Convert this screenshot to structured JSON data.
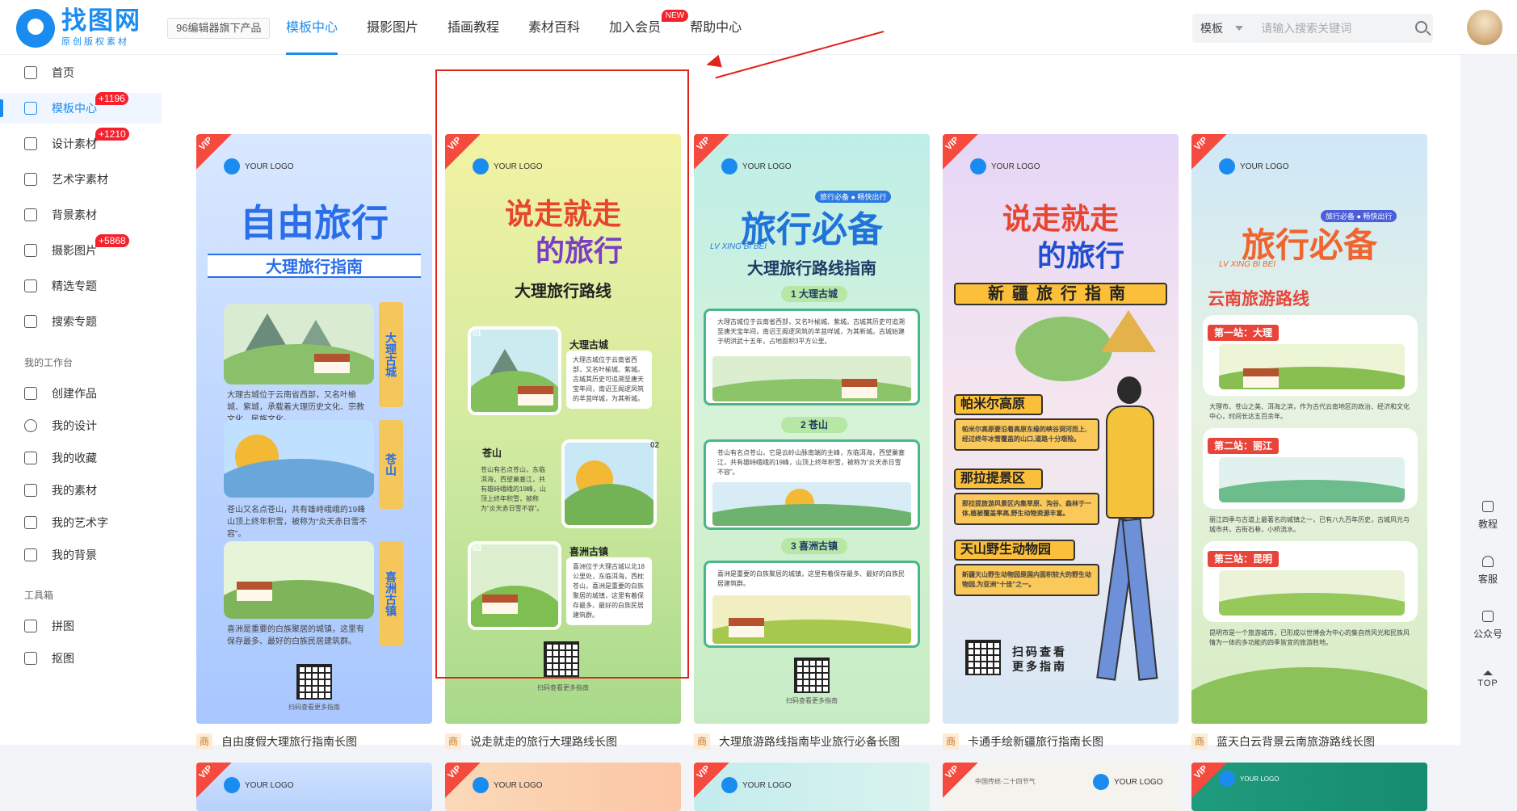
{
  "logo": {
    "name": "找图网",
    "subtitle": "原创版权素材"
  },
  "product_tag": "96编辑器旗下产品",
  "nav": [
    {
      "label": "模板中心",
      "active": true
    },
    {
      "label": "摄影图片"
    },
    {
      "label": "插画教程"
    },
    {
      "label": "素材百科"
    },
    {
      "label": "加入会员",
      "badge": "NEW"
    },
    {
      "label": "帮助中心"
    }
  ],
  "search": {
    "type": "模板",
    "placeholder": "请输入搜索关键词"
  },
  "sidebar": {
    "items": [
      {
        "label": "首页",
        "icon": "home-icon"
      },
      {
        "label": "模板中心",
        "icon": "template-icon",
        "badge": "+1196",
        "active": true
      },
      {
        "label": "设计素材",
        "icon": "design-material-icon",
        "badge": "+1210"
      },
      {
        "label": "艺术字素材",
        "icon": "art-text-icon"
      },
      {
        "label": "背景素材",
        "icon": "background-icon"
      },
      {
        "label": "摄影图片",
        "icon": "photo-icon",
        "badge": "+5868"
      },
      {
        "label": "精选专题",
        "icon": "featured-topic-icon"
      },
      {
        "label": "搜索专题",
        "icon": "search-topic-icon"
      }
    ],
    "workspace_title": "我的工作台",
    "workspace": [
      {
        "label": "创建作品",
        "icon": "create-icon"
      },
      {
        "label": "我的设计",
        "icon": "my-design-icon"
      },
      {
        "label": "我的收藏",
        "icon": "star-icon"
      },
      {
        "label": "我的素材",
        "icon": "folder-icon"
      },
      {
        "label": "我的艺术字",
        "icon": "letter-a-icon"
      },
      {
        "label": "我的背景",
        "icon": "texture-icon"
      }
    ],
    "tools_title": "工具箱",
    "tools": [
      {
        "label": "拼图",
        "icon": "collage-icon"
      },
      {
        "label": "抠图",
        "icon": "cutout-icon"
      }
    ]
  },
  "cards": [
    {
      "tag": "商",
      "title": "自由度假大理旅行指南长图",
      "vip": "VIP",
      "logo": "YOUR LOGO",
      "poster": {
        "headline": "自由旅行",
        "band": "大理旅行指南",
        "side1": "大理古城",
        "side2": "苍山",
        "side3": "喜洲古镇",
        "text1": "大理古城位于云南省西部，又名叶榆城、紫城，承载着大理历史文化、宗教文化、民族文化。",
        "text2": "苍山又名点苍山，共有雄峙峨峨的19峰山顶上终年积雪，被称为“炎天赤日雪不容”。",
        "text3": "喜洲是重要的白族聚居的城镇，这里有保存最多、最好的白族民居建筑群。",
        "qr_text": "扫码查看更多指南"
      }
    },
    {
      "tag": "商",
      "title": "说走就走的旅行大理路线长图",
      "vip": "VIP",
      "logo": "YOUR LOGO",
      "poster": {
        "headline1": "说走就走",
        "headline2": "的旅行",
        "band": "大理旅行路线",
        "s1": "大理古城",
        "n1": "01",
        "s2": "苍山",
        "n2": "02",
        "s3": "喜洲古镇",
        "n3": "03",
        "t1": "大理古城位于云南省西部，又名叶榆城、紫城。古城其历史可追溯至唐天宝年间，南诏王阁逻凤筑的羊苴咩城，为其新城。",
        "t2": "苍山有名点苍山，东临洱海，西望巢塞江，共有雄峙峨峨的19峰，山顶上终年积雪，被称为“炎天赤日雪不容”。",
        "t3": "喜洲位于大理古城以北18公里处，东临洱海，西枕苍山，喜洲是重要的白族聚居的城镇，这里有着保存最多、最好的白族民居建筑群。",
        "qr_text": "扫码查看更多指南"
      }
    },
    {
      "tag": "商",
      "title": "大理旅游路线指南毕业旅行必备长图",
      "vip": "VIP",
      "logo": "YOUR LOGO",
      "poster": {
        "headline": "旅行必备",
        "tagline": "旅行必备 ● 畅快出行",
        "pinyin": "LV  XING  BI  BEI",
        "band": "大理旅行路线指南",
        "s1": "1 大理古城",
        "s2": "2 苍山",
        "s3": "3 喜洲古镇",
        "t1": "大理古城位于云南省西部，又名叶榆城、紫城。古城其历史可追溯至唐天宝年间，南诏王阁逻凤筑的羊苴咩城，为其新城。古城始建于明洪武十五年，占地面积3平方公里。",
        "t2": "苍山有名点苍山，它是云岭山脉南端的主峰，东临洱海，西望巢塞江，共有雄峙峨峨的19峰，山顶上终年积雪，被称为“炎天赤日雪不容”。",
        "t3": "喜洲是重要的白族聚居的城镇，这里有着保存最多、最好的白族民居建筑群。",
        "qr_text": "扫码查看更多指南"
      }
    },
    {
      "tag": "商",
      "title": "卡通手绘新疆旅行指南长图",
      "vip": "VIP",
      "logo": "YOUR LOGO",
      "poster": {
        "headline1": "说走就走",
        "headline2": "的旅行",
        "band": "新疆旅行指南",
        "s1": "帕米尔高原",
        "t1": "帕米尔高原要沿着高原东缘的峡谷洞河而上,经过终年冰雪覆盖的山口,道路十分艰险。",
        "s2": "那拉提景区",
        "t2": "那拉提旅游风景区内集草原、沟谷、森林于一体,植被覆盖率高,野生动物资源丰富。",
        "s3": "天山野生动物园",
        "t3": "新疆天山野生动物园是国内面积较大的野生动物园,为亚洲“十佳”之一。",
        "qr_text": "扫码查看更多指南"
      }
    },
    {
      "tag": "商",
      "title": "蓝天白云背景云南旅游路线长图",
      "vip": "VIP",
      "logo": "YOUR LOGO",
      "poster": {
        "headline": "旅行必备",
        "tagline": "旅行必备 ● 畅快出行",
        "pinyin": "LV  XING  BI  BEI",
        "band": "云南旅游路线",
        "s1": "第一站：大理",
        "s2": "第二站：丽江",
        "s3": "第三站：昆明",
        "t1": "大理市、苍山之美、洱海之滨，作为古代云南地区的政治、经济和文化中心，时间长达五百余年。",
        "t2": "丽江四季与古道上最著名的城镇之一，已有八九百年历史，古城风光与城市共，古街石巷，小桥流水。",
        "t3": "昆明市是一个旅游城市，已形成以世博会为中心的集自然风光和民族风情为一体的多功能的四季皆宜的旅游胜地。"
      }
    }
  ],
  "second_row": [
    {
      "vip": "VIP",
      "logo": "YOUR LOGO"
    },
    {
      "vip": "VIP",
      "logo": "YOUR LOGO"
    },
    {
      "vip": "VIP",
      "logo": "YOUR LOGO"
    },
    {
      "vip": "VIP",
      "logo": "YOUR LOGO",
      "caption": "中国传统·二十四节气"
    },
    {
      "vip": "VIP",
      "logo": "YOUR LOGO"
    }
  ],
  "right_tools": [
    {
      "label": "教程",
      "icon": "tutorial-icon"
    },
    {
      "label": "客服",
      "icon": "headset-icon"
    },
    {
      "label": "公众号",
      "icon": "qrcode-icon"
    },
    {
      "label": "TOP",
      "icon": "caret-up-icon"
    }
  ],
  "colors": {
    "accent": "#1a8cf0",
    "badge_red": "#f5222d",
    "highlight": "#e0241b"
  }
}
